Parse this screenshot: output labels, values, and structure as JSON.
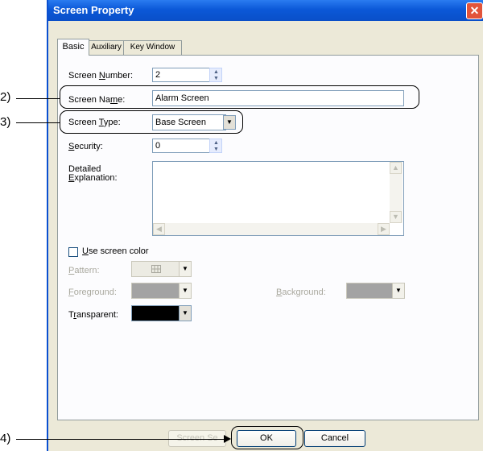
{
  "window": {
    "title": "Screen Property",
    "close_glyph": "✕"
  },
  "tabs": [
    {
      "label": "Basic",
      "active": true
    },
    {
      "label": "Auxiliary",
      "active": false
    },
    {
      "label": "Key Window",
      "active": false
    }
  ],
  "basic": {
    "screen_number": {
      "label_pre": "Screen ",
      "label_key": "N",
      "label_post": "umber:",
      "value": "2"
    },
    "screen_name": {
      "label_pre": "Screen Na",
      "label_key": "m",
      "label_post": "e:",
      "value": "Alarm Screen"
    },
    "screen_type": {
      "label_pre": "Screen ",
      "label_key": "T",
      "label_post": "ype:",
      "value": "Base Screen"
    },
    "security": {
      "label_pre": "",
      "label_key": "S",
      "label_post": "ecurity:",
      "value": "0"
    },
    "detailed_explanation": {
      "label_line1": "Detailed",
      "label_key": "E",
      "label_post": "xplanation:",
      "value": ""
    },
    "use_screen_color": {
      "label_key": "U",
      "label_post": "se screen color",
      "checked": false
    },
    "pattern": {
      "label_key": "P",
      "label_post": "attern:"
    },
    "foreground": {
      "label_key": "F",
      "label_post": "oreground:"
    },
    "background": {
      "label_key": "B",
      "label_post": "ackground:"
    },
    "transparent": {
      "label_pre": "T",
      "label_key": "r",
      "label_post": "ansparent:",
      "color": "#000000"
    }
  },
  "buttons": {
    "screen_set": "Screen Se",
    "ok": "OK",
    "cancel": "Cancel"
  },
  "callouts": {
    "c2": "2)",
    "c3": "3)",
    "c4": "4)"
  },
  "colors": {
    "title_bar": "#0b58d8",
    "dialog_bg": "#ece9d8",
    "panel_bg": "#fcfcfe"
  }
}
